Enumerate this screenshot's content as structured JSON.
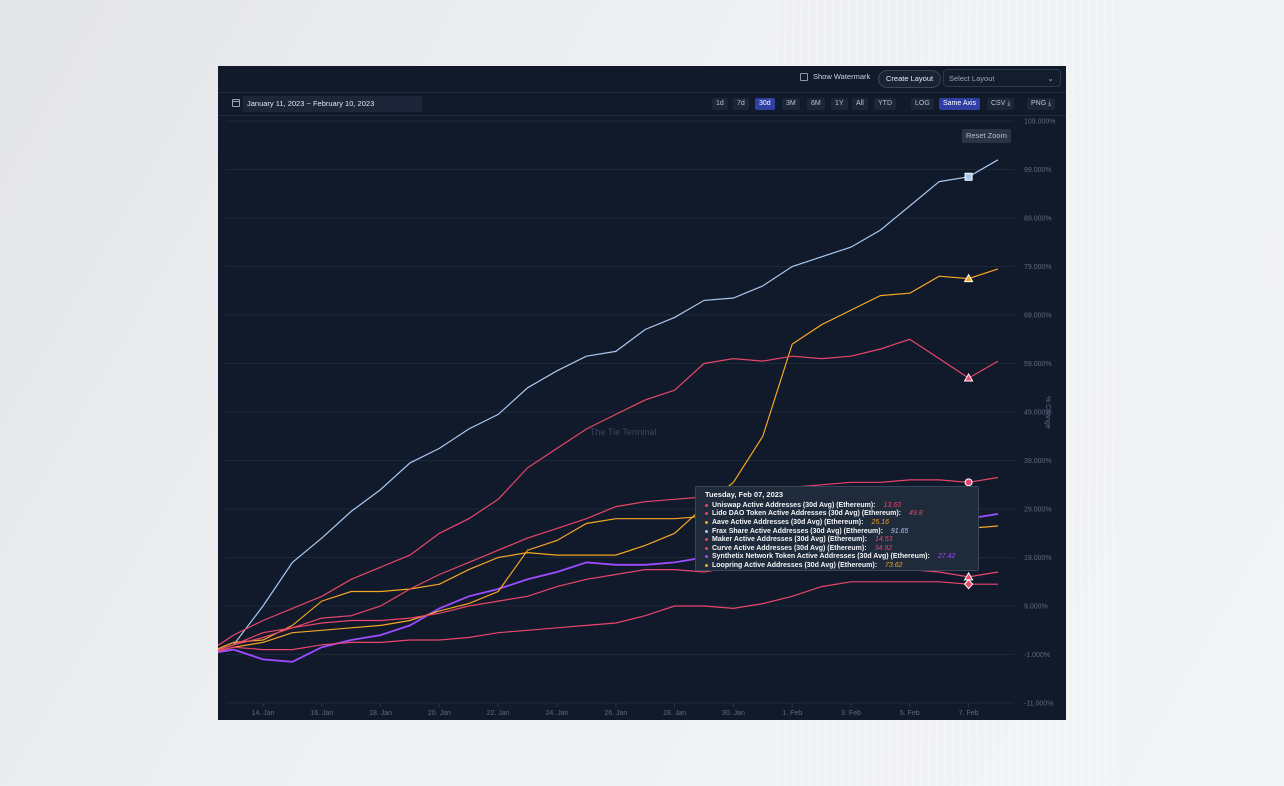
{
  "topbar": {
    "show_watermark": "Show Watermark",
    "create_layout": "Create Layout",
    "select_layout_placeholder": "Select Layout"
  },
  "toolbar": {
    "date_range": "January 11, 2023 ~ February 10, 2023",
    "ranges": [
      "1d",
      "7d",
      "30d",
      "3M",
      "6M",
      "1Y",
      "All",
      "YTD"
    ],
    "active_range": "30d",
    "log": "LOG",
    "same_axis": "Same Axis",
    "csv": "CSV",
    "png": "PNG"
  },
  "reset_zoom": "Reset Zoom",
  "watermark_text": "The Tie Terminal",
  "tooltip": {
    "title": "Tuesday, Feb 07, 2023",
    "rows": [
      {
        "label": "Uniswap Active Addresses (30d Avg) (Ethereum):",
        "value": "13.63",
        "color": "#e8466b"
      },
      {
        "label": "Lido DAO Token Active Addresses (30d Avg) (Ethereum):",
        "value": "49.8",
        "color": "#e8466b"
      },
      {
        "label": "Aave Active Addresses (30d Avg) (Ethereum):",
        "value": "25.16",
        "color": "#f5a623"
      },
      {
        "label": "Frax Share Active Addresses (30d Avg) (Ethereum):",
        "value": "91.65",
        "color": "#a9c9ef"
      },
      {
        "label": "Maker Active Addresses (30d Avg) (Ethereum):",
        "value": "14.53",
        "color": "#e8466b"
      },
      {
        "label": "Curve Active Addresses (30d Avg) (Ethereum):",
        "value": "34.92",
        "color": "#e8466b"
      },
      {
        "label": "Synthetix Network Token Active Addresses (30d Avg) (Ethereum):",
        "value": "27.42",
        "color": "#9d4dff"
      },
      {
        "label": "Loopring Active Addresses (30d Avg) (Ethereum):",
        "value": "73.62",
        "color": "#f5a623"
      }
    ]
  },
  "chart_data": {
    "type": "line",
    "title": "",
    "xlabel": "",
    "ylabel": "% Change",
    "x_ticks": [
      "14. Jan",
      "16. Jan",
      "18. Jan",
      "20. Jan",
      "22. Jan",
      "24. Jan",
      "26. Jan",
      "28. Jan",
      "30. Jan",
      "1. Feb",
      "3. Feb",
      "5. Feb",
      "7. Feb"
    ],
    "y_ticks": [
      "109.000%",
      "99.000%",
      "89.000%",
      "79.000%",
      "69.000%",
      "59.000%",
      "49.000%",
      "39.000%",
      "29.000%",
      "19.000%",
      "9.000%",
      "-1.000%",
      "-11.000%"
    ],
    "ylim": [
      -11,
      109
    ],
    "x_start": "12. Jan",
    "x_end": "8. Feb",
    "marker_date": "7. Feb",
    "series": [
      {
        "name": "Frax Share Active Addresses (30d Avg) (Ethereum)",
        "color": "#a9c9ef",
        "marker": "square",
        "values": [
          -1,
          1,
          9,
          18,
          23,
          28.5,
          33,
          38.5,
          41.5,
          45.5,
          48.5,
          54,
          57.5,
          60.5,
          61.5,
          66,
          68.5,
          72,
          72.5,
          75,
          79,
          81,
          83,
          86.5,
          91.5,
          96.5,
          97.5,
          101
        ]
      },
      {
        "name": "Loopring Active Addresses (30d Avg) (Ethereum)",
        "color": "#f5a623",
        "marker": "triangle",
        "values": [
          -1,
          1.5,
          2,
          5,
          10,
          12,
          12,
          12.5,
          13.5,
          16.5,
          19,
          20,
          19.5,
          19.5,
          19.5,
          21.5,
          24,
          29.5,
          34.5,
          44,
          63,
          67,
          70,
          73,
          73.5,
          77,
          76.5,
          78.5
        ]
      },
      {
        "name": "Lido DAO Token Active Addresses (30d Avg) (Ethereum)",
        "color": "#e8466b",
        "marker": "triangle",
        "values": [
          -1,
          3,
          6,
          8.5,
          11,
          14.5,
          17,
          19.5,
          24,
          27,
          31,
          37.5,
          41.5,
          45.5,
          48.5,
          51.5,
          53.5,
          59,
          60,
          59.5,
          60.5,
          60,
          60.5,
          62,
          64,
          60,
          56,
          59.5
        ]
      },
      {
        "name": "Curve Active Addresses (30d Avg) (Ethereum)",
        "color": "#e8466b",
        "marker": "circle",
        "values": [
          -1,
          1,
          3.5,
          4.5,
          6.5,
          7,
          9,
          12.5,
          15.5,
          18,
          20.5,
          23,
          25,
          27,
          29.5,
          30.5,
          31,
          31.5,
          32,
          33,
          33.5,
          34,
          34.5,
          34.5,
          35,
          35,
          34.5,
          35.5
        ]
      },
      {
        "name": "Synthetix Network Token Active Addresses (30d Avg) (Ethereum)",
        "color": "#9d4dff",
        "marker": "diamond",
        "values": [
          -1,
          0,
          -2,
          -2.5,
          0.5,
          2,
          3,
          5,
          8.5,
          11,
          12.5,
          14.5,
          16,
          18,
          17.5,
          17.5,
          18,
          19,
          20.5,
          21.5,
          22.5,
          23.5,
          24.5,
          25.5,
          26,
          26.5,
          27,
          28
        ]
      },
      {
        "name": "Aave Active Addresses (30d Avg) (Ethereum)",
        "color": "#f5a623",
        "marker": "circle",
        "values": [
          -1,
          0.5,
          1.5,
          3.5,
          4,
          4.5,
          5,
          6,
          8,
          9.5,
          12,
          20.5,
          22.5,
          26,
          27,
          27,
          27,
          27.5,
          27,
          25.5,
          25,
          24.5,
          24.5,
          24.5,
          24.5,
          25,
          25,
          25.5
        ]
      },
      {
        "name": "Maker Active Addresses (30d Avg) (Ethereum)",
        "color": "#e8466b",
        "marker": "triangle",
        "values": [
          -1,
          1,
          2.5,
          4.5,
          5.5,
          6,
          6,
          6.5,
          7.5,
          9,
          10,
          11,
          13,
          14.5,
          15.5,
          16.5,
          16.5,
          16,
          17,
          18.5,
          19.5,
          17,
          17,
          16.5,
          16.5,
          16,
          15,
          16
        ]
      },
      {
        "name": "Uniswap Active Addresses (30d Avg) (Ethereum)",
        "color": "#e8466b",
        "marker": "diamond",
        "values": [
          -1,
          0.5,
          0,
          0,
          1,
          1.5,
          1.5,
          2,
          2,
          2.5,
          3.5,
          4,
          4.5,
          5,
          5.5,
          7,
          9,
          9,
          8.5,
          9.5,
          11,
          13,
          14,
          14,
          14,
          14,
          13.5,
          13.5
        ]
      }
    ]
  }
}
